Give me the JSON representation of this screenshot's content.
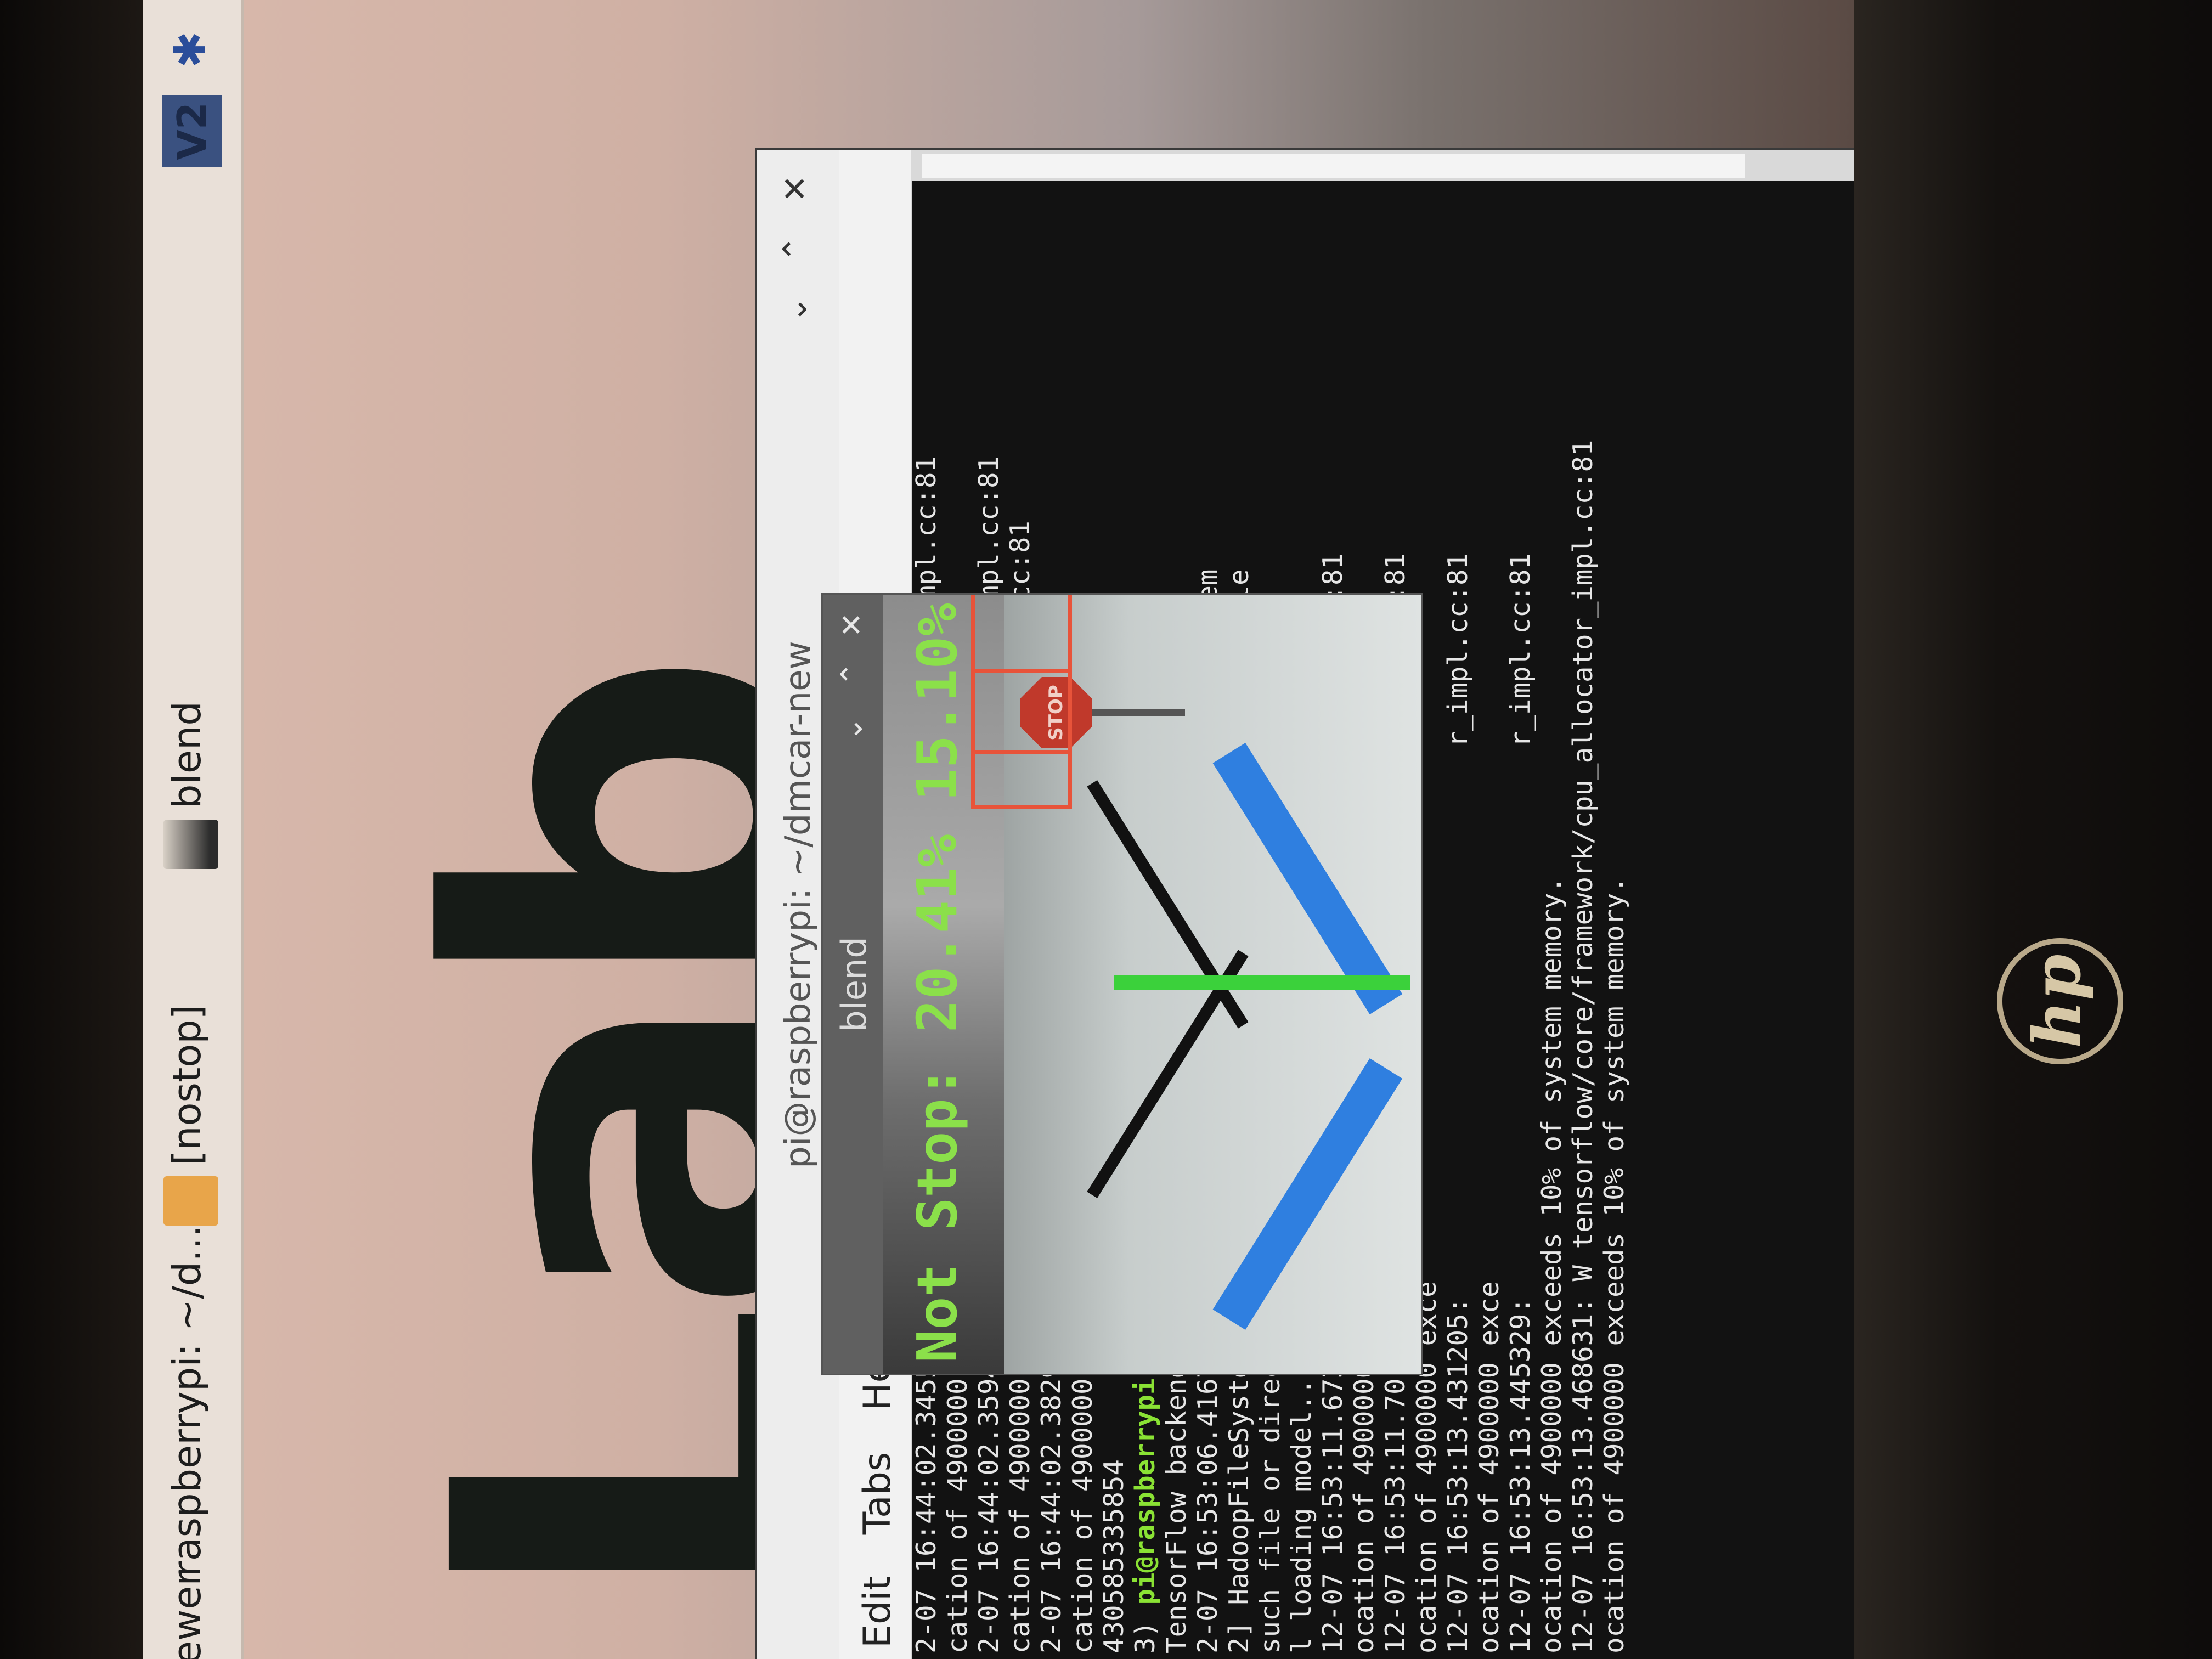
{
  "taskbar": {
    "app_viewer": "ewer",
    "task_terminal": "raspberrypi: ~/d...",
    "task_nostop": "[nostop]",
    "task_blend": "blend",
    "bluetooth_icon": "bluetooth-icon",
    "vnc_icon_label": "V2"
  },
  "wallpaper": {
    "big_text": "Lab"
  },
  "terminal": {
    "title": "pi@raspberrypi: ~/dmcar-new",
    "menu": [
      "Edit",
      "Tabs",
      "Help"
    ],
    "lines": [
      {
        "t": "2-07 16:44:02.345540: W tensorflow/core/framework/cpu_allocator_impl.cc:81"
      },
      {
        "t": "cation of 4900000 exceeds 10% of system memory."
      },
      {
        "t": "2-07 16:44:02.359482: W tensorflow/core/framework/cpu_allocator_impl.cc:81"
      },
      {
        "t": "cation of 4900000 exce                                    r_impl.cc:81"
      },
      {
        "t": "2-07 16:44:02.382986:"
      },
      {
        "t": "cation of 4900000 exce"
      },
      {
        "t": "430585335854"
      },
      {
        "t": "3) ",
        "p": "pi@raspberrypi",
        "d": ":~/dm"
      },
      {
        "t": "TensorFlow backend."
      },
      {
        "t": "2-07 16:53:06.416752:                                   file_system"
      },
      {
        "t": "2] HadoopFileSystem lo                                  object file"
      },
      {
        "t": "such file or directory"
      },
      {
        "t": "l loading model..."
      },
      {
        "t": "12-07 16:53:11.673752:                                  r_impl.cc:81"
      },
      {
        "t": "ocation of 4900000 exce"
      },
      {
        "t": "12-07 16:53:11.701306:                                  r_impl.cc:81"
      },
      {
        "t": "ocation of 4900000 exce"
      },
      {
        "t": "12-07 16:53:13.431205:                                  r_impl.cc:81"
      },
      {
        "t": "ocation of 4900000 exce"
      },
      {
        "t": "12-07 16:53:13.445329:                                  r_impl.cc:81"
      },
      {
        "t": "ocation of 4900000 exceeds 10% of system memory."
      },
      {
        "t": "12-07 16:53:13.468631: W tensorflow/core/framework/cpu_allocator_impl.cc:81"
      },
      {
        "t": "ocation of 4900000 exceeds 10% of system memory."
      }
    ]
  },
  "blend_window": {
    "title": "blend",
    "overlay_text": "Not Stop: 20.41% 15.10%",
    "stop_sign_text": "STOP"
  },
  "laptop": {
    "brand": "hp"
  },
  "colors": {
    "prompt_green": "#8ae234",
    "overlay_green": "#8be04a",
    "detection_box": "#e8533a",
    "lane_blue": "#2f7fe0"
  }
}
